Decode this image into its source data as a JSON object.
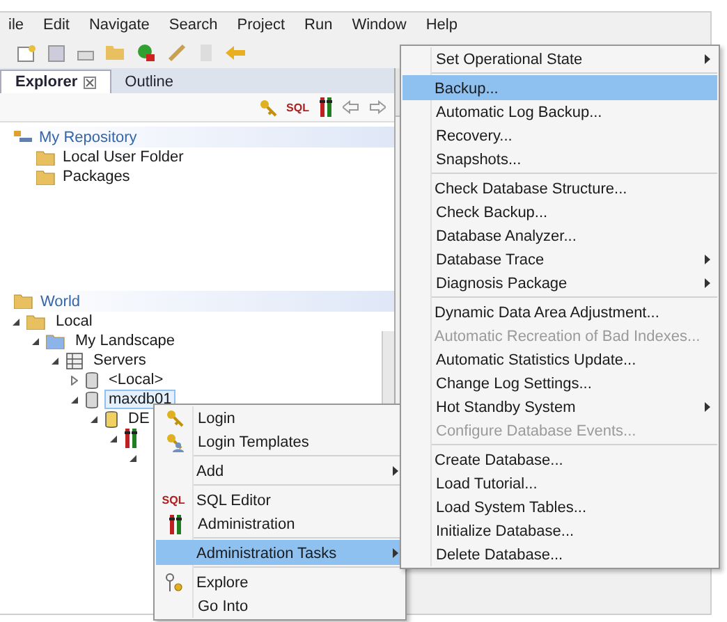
{
  "menu_bar": [
    "ile",
    "Edit",
    "Navigate",
    "Search",
    "Project",
    "Run",
    "Window",
    "Help"
  ],
  "tabs": [
    {
      "label": "Explorer",
      "selected": true
    },
    {
      "label": "Outline",
      "selected": false
    }
  ],
  "view_toolbar": {
    "sql_label": "SQL"
  },
  "repository": {
    "title": "My Repository",
    "items": [
      "Local User Folder",
      "Packages"
    ]
  },
  "world": {
    "title": "World",
    "tree": [
      {
        "label": "Local",
        "kind": "folder",
        "expanded": true,
        "selected": false,
        "children": [
          {
            "label": "My Landscape",
            "kind": "landscape",
            "expanded": true,
            "selected": false,
            "children": [
              {
                "label": "Servers",
                "kind": "servers",
                "expanded": true,
                "selected": false,
                "children": [
                  {
                    "label": "<Local>",
                    "kind": "database",
                    "expanded": false,
                    "selected": false
                  },
                  {
                    "label": "maxdb01",
                    "kind": "database",
                    "expanded": true,
                    "selected": true,
                    "children": [
                      {
                        "label": "DE",
                        "kind": "instance",
                        "expanded": true,
                        "selected": false,
                        "children": [
                          {
                            "kind": "tools",
                            "expanded": true,
                            "children": [
                              {
                                "expanded": true
                              }
                            ]
                          }
                        ]
                      }
                    ]
                  }
                ]
              }
            ]
          }
        ]
      }
    ]
  },
  "context_menu": {
    "items": [
      {
        "label": "Login",
        "separator_before": false,
        "submenu": false,
        "selected": false
      },
      {
        "label": "Login Templates",
        "separator_before": false,
        "submenu": false,
        "selected": false
      },
      {
        "label": "Add",
        "separator_before": true,
        "submenu": true,
        "selected": false
      },
      {
        "label": "SQL Editor",
        "separator_before": true,
        "submenu": false,
        "selected": false,
        "icon_text": "SQL"
      },
      {
        "label": "Administration",
        "separator_before": false,
        "submenu": false,
        "selected": false
      },
      {
        "label": "Administration Tasks",
        "separator_before": true,
        "submenu": true,
        "selected": true
      },
      {
        "label": "Explore",
        "separator_before": true,
        "submenu": false,
        "selected": false
      },
      {
        "label": "Go Into",
        "separator_before": false,
        "submenu": false,
        "selected": false
      }
    ]
  },
  "submenu": {
    "items": [
      {
        "label": "Set Operational State",
        "separator_before": false,
        "submenu": true,
        "selected": false,
        "disabled": false
      },
      {
        "label": "Backup...",
        "separator_before": true,
        "submenu": false,
        "selected": true,
        "disabled": false
      },
      {
        "label": "Automatic Log Backup...",
        "separator_before": false,
        "submenu": false,
        "selected": false,
        "disabled": false
      },
      {
        "label": "Recovery...",
        "separator_before": false,
        "submenu": false,
        "selected": false,
        "disabled": false
      },
      {
        "label": "Snapshots...",
        "separator_before": false,
        "submenu": false,
        "selected": false,
        "disabled": false
      },
      {
        "label": "Check Database Structure...",
        "separator_before": true,
        "submenu": false,
        "selected": false,
        "disabled": false
      },
      {
        "label": "Check Backup...",
        "separator_before": false,
        "submenu": false,
        "selected": false,
        "disabled": false
      },
      {
        "label": "Database Analyzer...",
        "separator_before": false,
        "submenu": false,
        "selected": false,
        "disabled": false
      },
      {
        "label": "Database Trace",
        "separator_before": false,
        "submenu": true,
        "selected": false,
        "disabled": false
      },
      {
        "label": "Diagnosis Package",
        "separator_before": false,
        "submenu": true,
        "selected": false,
        "disabled": false
      },
      {
        "label": "Dynamic Data Area Adjustment...",
        "separator_before": true,
        "submenu": false,
        "selected": false,
        "disabled": false
      },
      {
        "label": "Automatic Recreation of Bad Indexes...",
        "separator_before": false,
        "submenu": false,
        "selected": false,
        "disabled": true
      },
      {
        "label": "Automatic Statistics Update...",
        "separator_before": false,
        "submenu": false,
        "selected": false,
        "disabled": false
      },
      {
        "label": "Change Log Settings...",
        "separator_before": false,
        "submenu": false,
        "selected": false,
        "disabled": false
      },
      {
        "label": "Hot Standby System",
        "separator_before": false,
        "submenu": true,
        "selected": false,
        "disabled": false
      },
      {
        "label": "Configure Database Events...",
        "separator_before": false,
        "submenu": false,
        "selected": false,
        "disabled": true
      },
      {
        "label": "Create Database...",
        "separator_before": true,
        "submenu": false,
        "selected": false,
        "disabled": false
      },
      {
        "label": "Load Tutorial...",
        "separator_before": false,
        "submenu": false,
        "selected": false,
        "disabled": false
      },
      {
        "label": "Load System Tables...",
        "separator_before": false,
        "submenu": false,
        "selected": false,
        "disabled": false
      },
      {
        "label": "Initialize Database...",
        "separator_before": false,
        "submenu": false,
        "selected": false,
        "disabled": false
      },
      {
        "label": "Delete Database...",
        "separator_before": false,
        "submenu": false,
        "selected": false,
        "disabled": false
      }
    ]
  }
}
